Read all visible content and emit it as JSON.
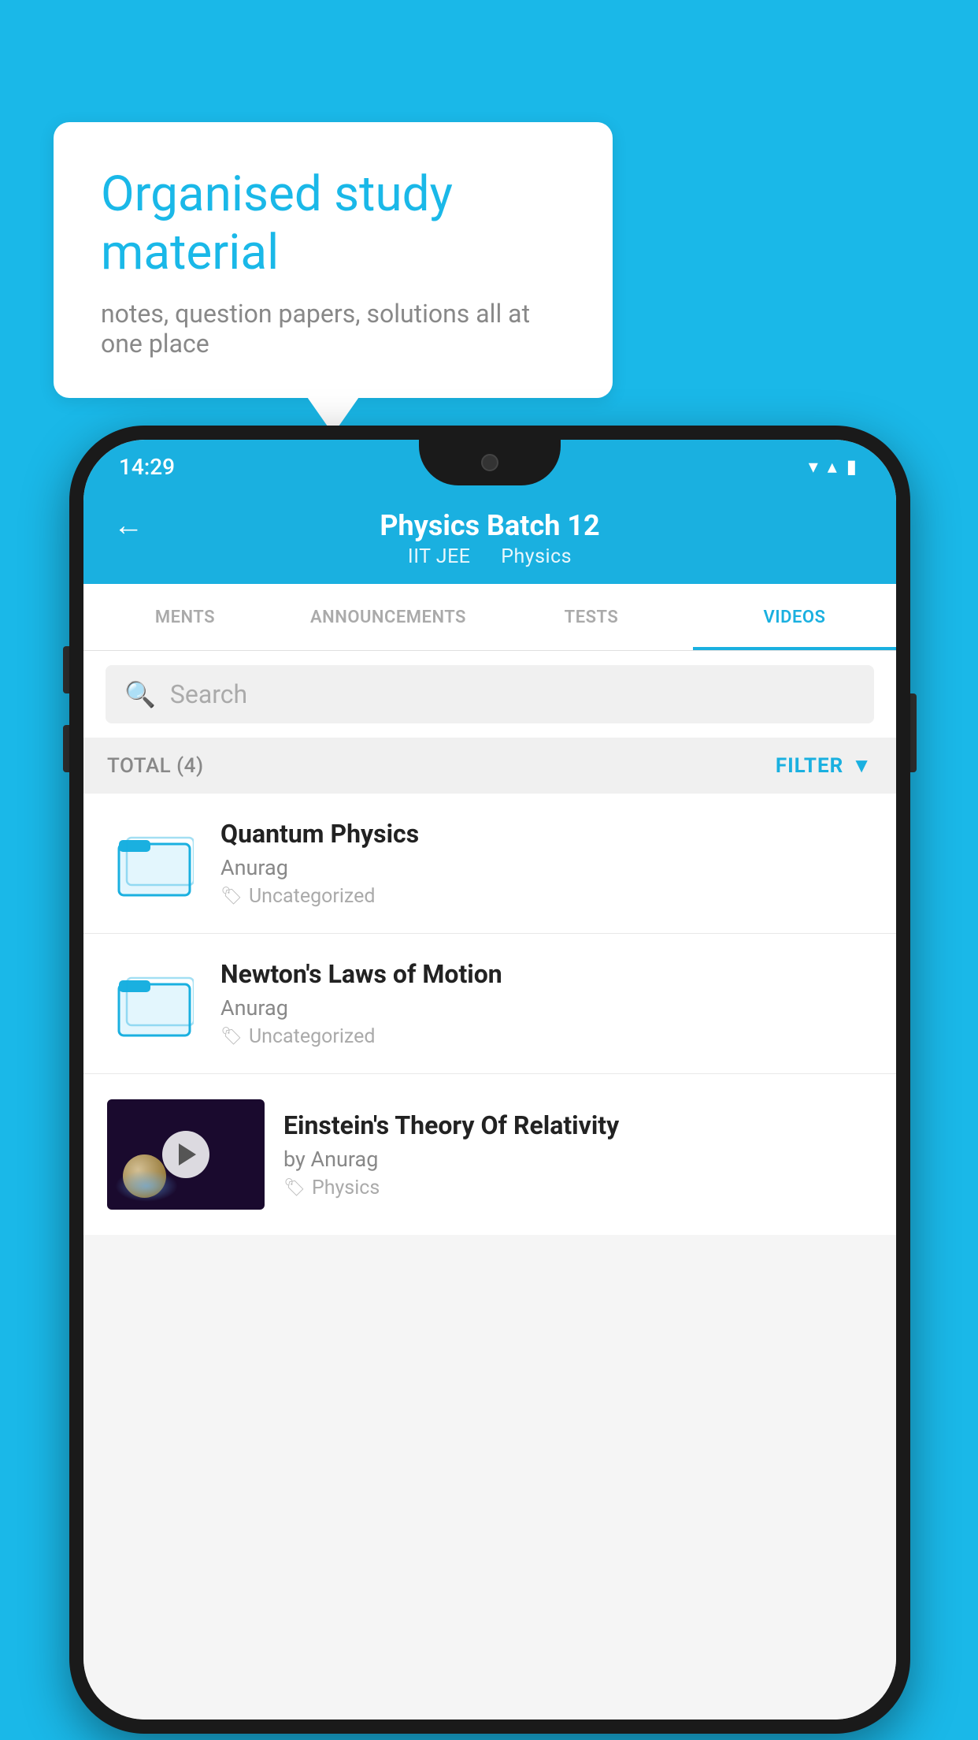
{
  "bubble": {
    "title": "Organised study material",
    "subtitle": "notes, question papers, solutions all at one place"
  },
  "status_bar": {
    "time": "14:29",
    "wifi_icon": "▼",
    "signal_icon": "▲",
    "battery_icon": "▮"
  },
  "header": {
    "back_label": "←",
    "title": "Physics Batch 12",
    "tag1": "IIT JEE",
    "tag2": "Physics"
  },
  "tabs": [
    {
      "label": "MENTS",
      "active": false
    },
    {
      "label": "ANNOUNCEMENTS",
      "active": false
    },
    {
      "label": "TESTS",
      "active": false
    },
    {
      "label": "VIDEOS",
      "active": true
    }
  ],
  "search": {
    "placeholder": "Search"
  },
  "filter": {
    "total_label": "TOTAL (4)",
    "filter_label": "FILTER"
  },
  "videos": [
    {
      "id": 1,
      "title": "Quantum Physics",
      "author": "Anurag",
      "tag": "Uncategorized",
      "type": "folder"
    },
    {
      "id": 2,
      "title": "Newton's Laws of Motion",
      "author": "Anurag",
      "tag": "Uncategorized",
      "type": "folder"
    },
    {
      "id": 3,
      "title": "Einstein's Theory Of Relativity",
      "author": "by Anurag",
      "tag": "Physics",
      "type": "video"
    }
  ],
  "colors": {
    "primary": "#1ab0e0",
    "background": "#1ab8e8",
    "white": "#ffffff",
    "text_dark": "#222222",
    "text_muted": "#888888",
    "text_light": "#aaaaaa"
  }
}
